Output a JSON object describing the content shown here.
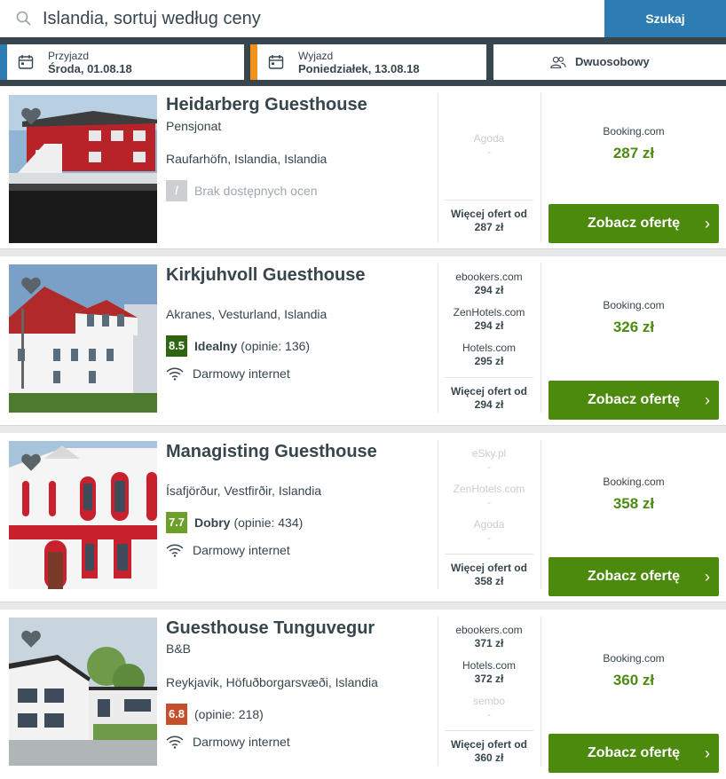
{
  "search": {
    "query": "Islandia, sortuj według ceny",
    "button": "Szukaj"
  },
  "checkin": {
    "label": "Przyjazd",
    "value": "Środa, 01.08.18"
  },
  "checkout": {
    "label": "Wyjazd",
    "value": "Poniedziałek, 13.08.18"
  },
  "guests": {
    "value": "Dwuosobowy"
  },
  "colors": {
    "accent_blue": "#2d7db3",
    "checkin_bar": "#2d7db3",
    "checkout_bar": "#f0921b",
    "cta_green": "#4c8a0d",
    "price_green": "#4b8c11",
    "score_dark": "#2f6410",
    "score_mid": "#6d9f2b",
    "score_low": "#c64f2b"
  },
  "results": [
    {
      "name": "Heidarberg Guesthouse",
      "type": "Pensjonat",
      "location": "Raufarhöfn, Islandia, Islandia",
      "rating": {
        "score": "/",
        "label": "Brak dostępnych ocen"
      },
      "deals": [
        {
          "name": "Agoda",
          "price": "-",
          "available": false
        }
      ],
      "more_label": "Więcej ofert od",
      "more_price": "287 zł",
      "best": {
        "provider": "Booking.com",
        "price": "287 zł"
      },
      "cta": "Zobacz ofertę"
    },
    {
      "name": "Kirkjuhvoll Guesthouse",
      "type": "",
      "location": "Akranes, Vesturland, Islandia",
      "rating": {
        "score": "8.5",
        "label": "Idealny",
        "reviews": "(opinie: 136)"
      },
      "amenity": "Darmowy internet",
      "deals": [
        {
          "name": "ebookers.com",
          "price": "294 zł",
          "available": true
        },
        {
          "name": "ZenHotels.com",
          "price": "294 zł",
          "available": true
        },
        {
          "name": "Hotels.com",
          "price": "295 zł",
          "available": true
        }
      ],
      "more_label": "Więcej ofert od",
      "more_price": "294 zł",
      "best": {
        "provider": "Booking.com",
        "price": "326 zł"
      },
      "cta": "Zobacz ofertę"
    },
    {
      "name": "Managisting Guesthouse",
      "type": "",
      "location": "Ísafjörður, Vestfirðir, Islandia",
      "rating": {
        "score": "7.7",
        "label": "Dobry",
        "reviews": "(opinie: 434)"
      },
      "amenity": "Darmowy internet",
      "deals": [
        {
          "name": "eSky.pl",
          "price": "-",
          "available": false
        },
        {
          "name": "ZenHotels.com",
          "price": "-",
          "available": false
        },
        {
          "name": "Agoda",
          "price": "-",
          "available": false
        }
      ],
      "more_label": "Więcej ofert od",
      "more_price": "358 zł",
      "best": {
        "provider": "Booking.com",
        "price": "358 zł"
      },
      "cta": "Zobacz ofertę"
    },
    {
      "name": "Guesthouse Tunguvegur",
      "type": "B&B",
      "location": "Reykjavik, Höfuðborgarsvæði, Islandia",
      "rating": {
        "score": "6.8",
        "label": "",
        "reviews": "(opinie: 218)"
      },
      "amenity": "Darmowy internet",
      "deals": [
        {
          "name": "ebookers.com",
          "price": "371 zł",
          "available": true
        },
        {
          "name": "Hotels.com",
          "price": "372 zł",
          "available": true
        },
        {
          "name": "sembo",
          "price": "-",
          "available": false
        }
      ],
      "more_label": "Więcej ofert od",
      "more_price": "360 zł",
      "best": {
        "provider": "Booking.com",
        "price": "360 zł"
      },
      "cta": "Zobacz ofertę"
    }
  ]
}
